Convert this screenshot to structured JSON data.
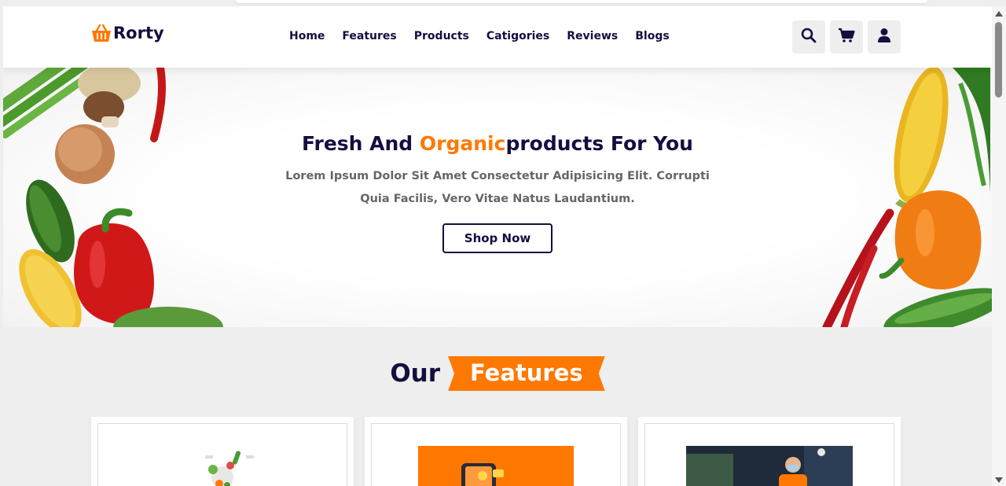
{
  "brand": {
    "name": "Rorty",
    "logo_icon": "basket-icon",
    "accent": "#ff7800",
    "dark": "#130f40"
  },
  "nav": [
    {
      "label": "Home"
    },
    {
      "label": "Features"
    },
    {
      "label": "Products"
    },
    {
      "label": "Catigories"
    },
    {
      "label": "Reviews"
    },
    {
      "label": "Blogs"
    }
  ],
  "header_icons": [
    "search-icon",
    "cart-icon",
    "user-icon"
  ],
  "hero": {
    "title_pre": "Fresh And ",
    "title_accent": "Organic",
    "title_post": "products For You",
    "description": "Lorem Ipsum Dolor Sit Amet Consectetur Adipisicing Elit. Corrupti Quia Facilis, Vero Vitae Natus Laudantium.",
    "button_label": "Shop Now"
  },
  "features": {
    "heading_plain": "Our",
    "heading_accent": "Features",
    "cards": [
      {
        "image": "vegetables-illustration"
      },
      {
        "image": "phone-delivery-illustration"
      },
      {
        "image": "delivery-person-photo"
      }
    ]
  }
}
